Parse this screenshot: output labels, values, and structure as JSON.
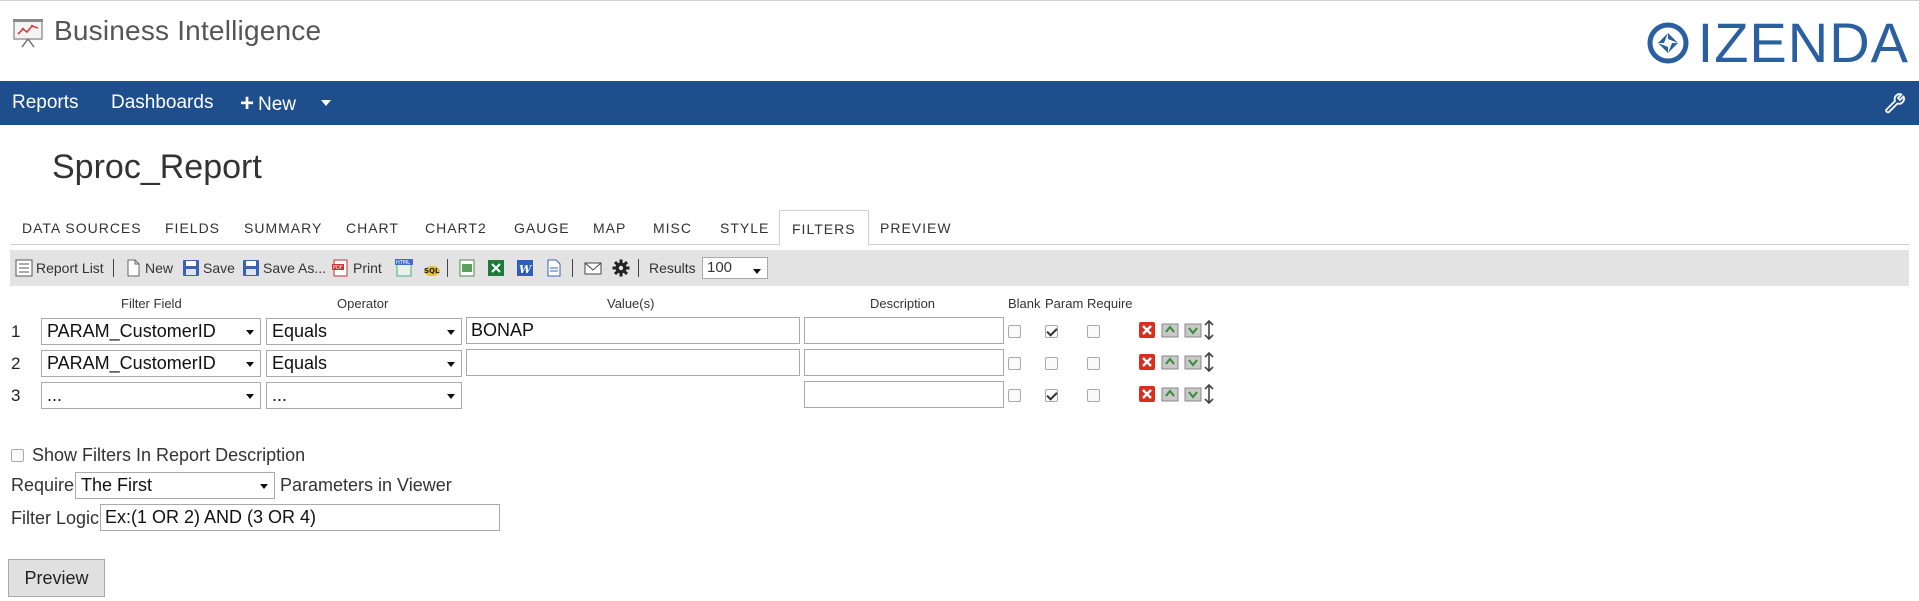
{
  "header": {
    "app_title": "Business Intelligence",
    "brand": "IZENDA"
  },
  "nav": {
    "reports": "Reports",
    "dashboards": "Dashboards",
    "new": "New"
  },
  "report": {
    "title": "Sproc_Report"
  },
  "tabs": [
    {
      "label": "DATA SOURCES"
    },
    {
      "label": "FIELDS"
    },
    {
      "label": "SUMMARY"
    },
    {
      "label": "CHART"
    },
    {
      "label": "CHART2"
    },
    {
      "label": "GAUGE"
    },
    {
      "label": "MAP"
    },
    {
      "label": "MISC"
    },
    {
      "label": "STYLE"
    },
    {
      "label": "FILTERS"
    },
    {
      "label": "PREVIEW"
    }
  ],
  "active_tab": "FILTERS",
  "toolbar": {
    "report_list": "Report List",
    "new": "New",
    "save": "Save",
    "save_as": "Save As...",
    "print": "Print",
    "results_label": "Results",
    "results_value": "100"
  },
  "filter_headers": {
    "field": "Filter Field",
    "operator": "Operator",
    "values": "Value(s)",
    "description": "Description",
    "blank": "Blank",
    "param": "Param",
    "require": "Require"
  },
  "filters": [
    {
      "num": "1",
      "field": "PARAM_CustomerID",
      "operator": "Equals",
      "value": "BONAP",
      "description": "",
      "blank": false,
      "param": true,
      "require": false
    },
    {
      "num": "2",
      "field": "PARAM_CustomerID",
      "operator": "Equals",
      "value": "",
      "description": "",
      "blank": false,
      "param": false,
      "require": false
    },
    {
      "num": "3",
      "field": "...",
      "operator": "...",
      "value": null,
      "description": "",
      "blank": false,
      "param": true,
      "require": false
    }
  ],
  "options": {
    "show_filters_label": "Show Filters In Report Description",
    "require_label": "Require",
    "require_value": "The First",
    "params_in_viewer": "Parameters in Viewer",
    "filter_logic_label": "Filter Logic",
    "filter_logic_value": "Ex:(1 OR 2) AND (3 OR 4)"
  },
  "preview_button": "Preview",
  "colors": {
    "nav_bg": "#1e4f8c",
    "brand": "#2a5fa0",
    "toolbar_bg": "#e3e3e3"
  }
}
